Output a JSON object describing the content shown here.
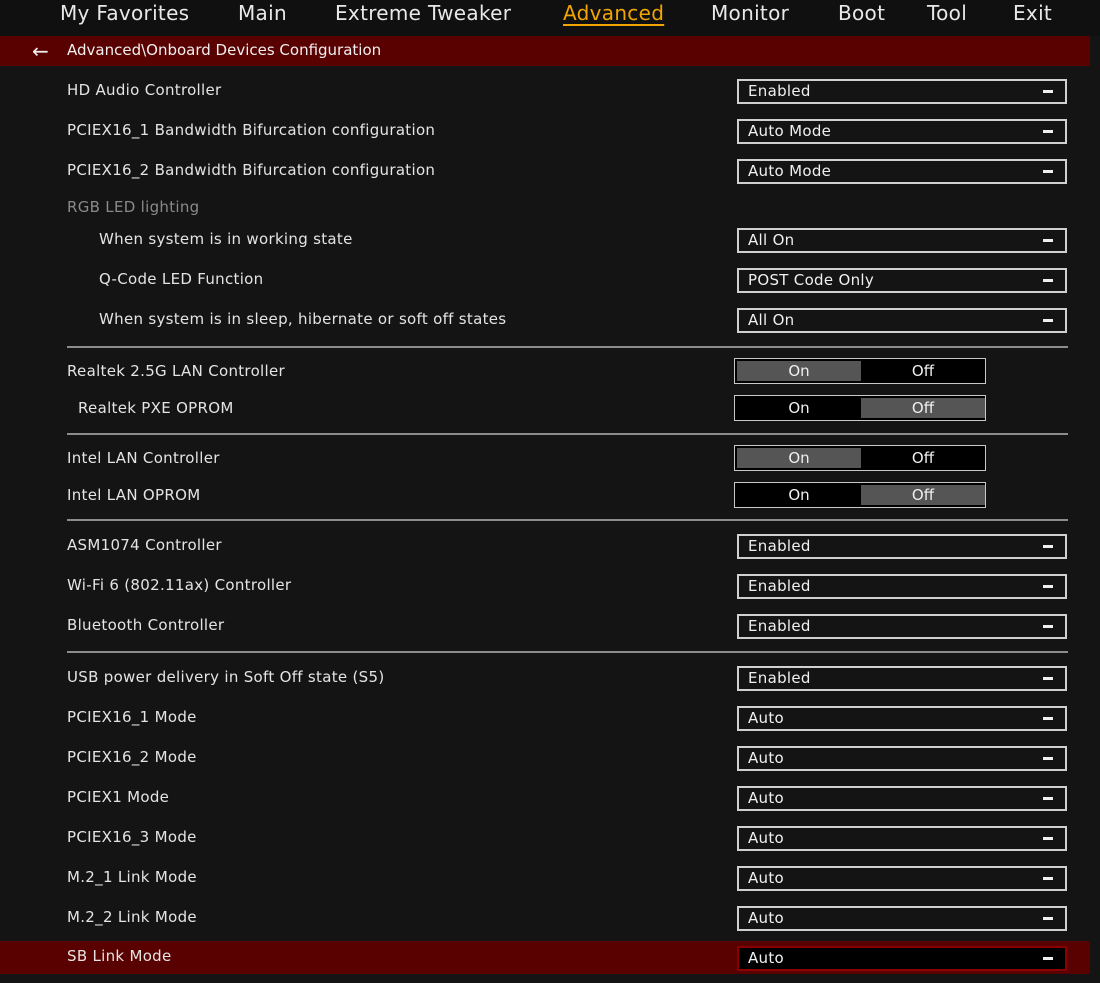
{
  "nav": {
    "tabs": [
      {
        "label": "My Favorites"
      },
      {
        "label": "Main"
      },
      {
        "label": "Extreme Tweaker"
      },
      {
        "label": "Advanced"
      },
      {
        "label": "Monitor"
      },
      {
        "label": "Boot"
      },
      {
        "label": "Tool"
      },
      {
        "label": "Exit"
      }
    ],
    "active": "Advanced"
  },
  "breadcrumb": {
    "path": "Advanced\\Onboard Devices Configuration",
    "back_icon": "arrow-left-icon"
  },
  "settings": [
    {
      "label": "HD Audio Controller",
      "value": "Enabled"
    },
    {
      "label": "PCIEX16_1 Bandwidth Bifurcation configuration",
      "value": "Auto Mode"
    },
    {
      "label": "PCIEX16_2 Bandwidth Bifurcation configuration",
      "value": "Auto Mode"
    },
    {
      "label": "RGB LED lighting"
    },
    {
      "label": "When system is in working state",
      "value": "All On"
    },
    {
      "label": "Q-Code LED Function",
      "value": "POST Code Only"
    },
    {
      "label": "When system is in sleep, hibernate or soft off states",
      "value": "All On"
    },
    {
      "label": "Realtek 2.5G LAN Controller",
      "on": "On",
      "off": "Off",
      "selected": "On"
    },
    {
      "label": "Realtek PXE OPROM",
      "on": "On",
      "off": "Off",
      "selected": "Off"
    },
    {
      "label": "Intel LAN Controller",
      "on": "On",
      "off": "Off",
      "selected": "On"
    },
    {
      "label": "Intel LAN OPROM",
      "on": "On",
      "off": "Off",
      "selected": "Off"
    },
    {
      "label": "ASM1074 Controller",
      "value": "Enabled"
    },
    {
      "label": "Wi-Fi 6 (802.11ax) Controller",
      "value": "Enabled"
    },
    {
      "label": "Bluetooth Controller",
      "value": "Enabled"
    },
    {
      "label": "USB power delivery in Soft Off state (S5)",
      "value": "Enabled"
    },
    {
      "label": "PCIEX16_1 Mode",
      "value": "Auto"
    },
    {
      "label": "PCIEX16_2 Mode",
      "value": "Auto"
    },
    {
      "label": "PCIEX1 Mode",
      "value": "Auto"
    },
    {
      "label": "PCIEX16_3 Mode",
      "value": "Auto"
    },
    {
      "label": "M.2_1 Link Mode",
      "value": "Auto"
    },
    {
      "label": "M.2_2 Link Mode",
      "value": "Auto"
    },
    {
      "label": "SB Link Mode",
      "value": "Auto"
    }
  ],
  "colors": {
    "accent": "#f0a500",
    "header_bar": "#590000",
    "background": "#141414"
  }
}
